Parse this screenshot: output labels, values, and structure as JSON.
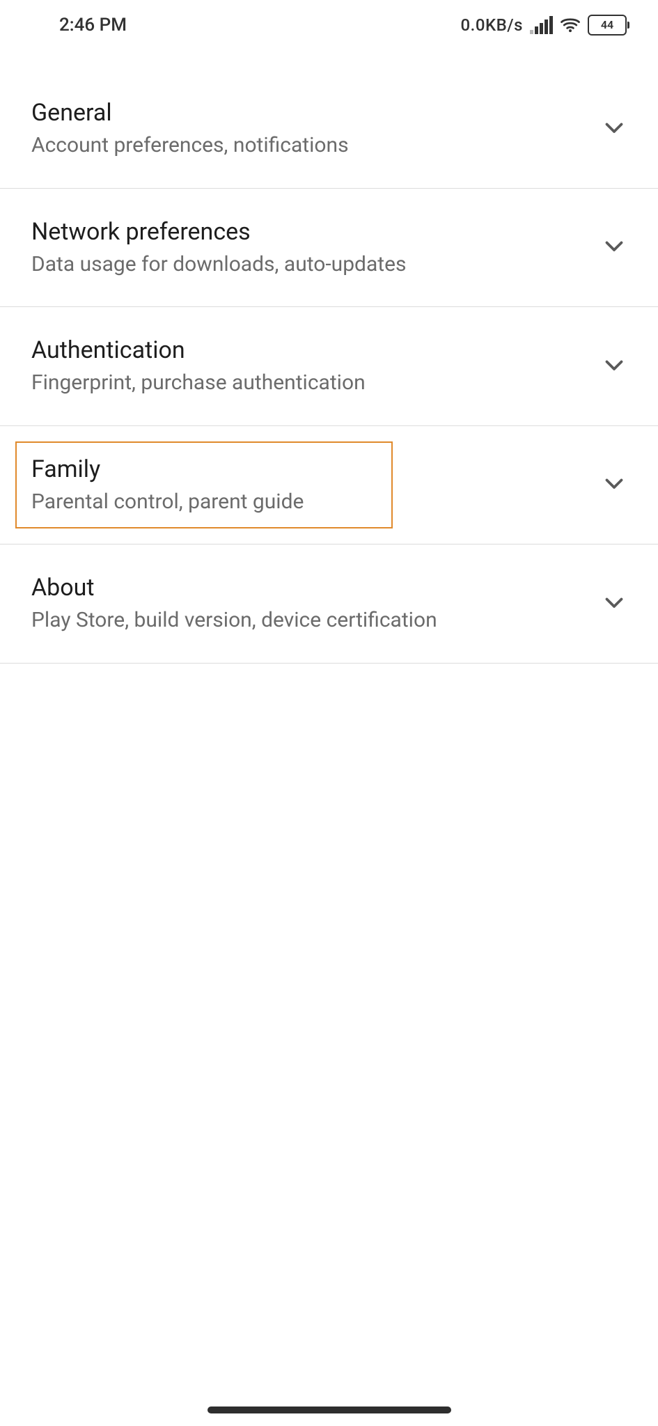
{
  "status": {
    "time": "2:46 PM",
    "speed": "0.0KB/s",
    "battery": "44"
  },
  "settings": [
    {
      "id": "general",
      "title": "General",
      "subtitle": "Account preferences, notifications",
      "highlighted": false
    },
    {
      "id": "network",
      "title": "Network preferences",
      "subtitle": "Data usage for downloads, auto-updates",
      "highlighted": false
    },
    {
      "id": "authentication",
      "title": "Authentication",
      "subtitle": "Fingerprint, purchase authentication",
      "highlighted": false
    },
    {
      "id": "family",
      "title": "Family",
      "subtitle": "Parental control, parent guide",
      "highlighted": true
    },
    {
      "id": "about",
      "title": "About",
      "subtitle": "Play Store, build version, device certification",
      "highlighted": false
    }
  ]
}
